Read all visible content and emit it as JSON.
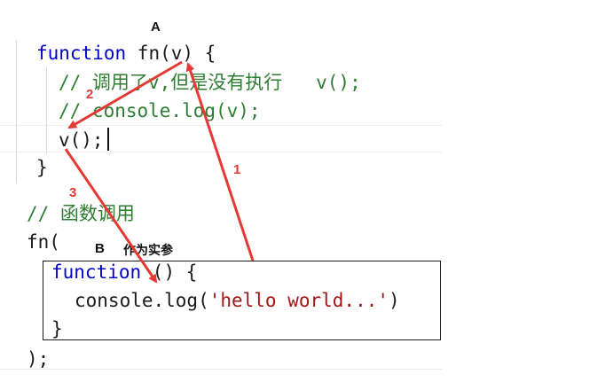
{
  "annotations": {
    "label_a": "A",
    "label_b": "B",
    "label_b_note": "作为实参",
    "step_1": "1",
    "step_2": "2",
    "step_3": "3",
    "arrow_color": "#e53935"
  },
  "code": {
    "line1": {
      "keyword": "function",
      "rest": " fn(v) {"
    },
    "line2": {
      "comment": "// 调用了v,但是没有执行   v();"
    },
    "line3": {
      "comment": "// console.log(v);"
    },
    "line4": {
      "text": "v();"
    },
    "line5": {
      "text": "}"
    },
    "line6": {
      "comment": "// 函数调用"
    },
    "line7": {
      "text": "fn("
    },
    "line8": {
      "keyword": "function",
      "rest": " () {"
    },
    "line9": {
      "prefix": "console.log(",
      "string": "'hello world...'",
      "suffix": ")"
    },
    "line10": {
      "text": "}"
    },
    "line11": {
      "text": ");"
    }
  },
  "colors": {
    "keyword": "#0000cc",
    "comment": "#2e7d32",
    "string": "#a31515"
  }
}
